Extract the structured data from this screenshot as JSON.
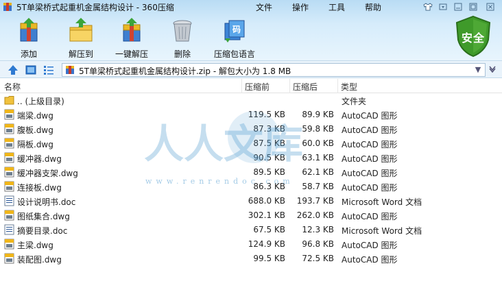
{
  "window": {
    "title": "5T单梁桥式起重机金属结构设计 - 360压缩",
    "menus": [
      "文件",
      "操作",
      "工具",
      "帮助"
    ]
  },
  "toolbar": {
    "add": "添加",
    "extract_to": "解压到",
    "one_click_extract": "一键解压",
    "delete": "删除",
    "archive_language": "压缩包语言",
    "security_badge": "安全"
  },
  "address": {
    "path": "5T单梁桥式起重机金属结构设计.zip - 解包大小为 1.8 MB"
  },
  "columns": {
    "name": "名称",
    "original_size": "压缩前",
    "compressed_size": "压缩后",
    "type": "类型"
  },
  "files": [
    {
      "name": ".. (上级目录)",
      "original": "",
      "compressed": "",
      "type": "文件夹",
      "icon": "folder-icon"
    },
    {
      "name": "端梁.dwg",
      "original": "119.5 KB",
      "compressed": "89.9 KB",
      "type": "AutoCAD 图形",
      "icon": "dwg-file-icon"
    },
    {
      "name": "腹板.dwg",
      "original": "87.3 KB",
      "compressed": "59.8 KB",
      "type": "AutoCAD 图形",
      "icon": "dwg-file-icon"
    },
    {
      "name": "隔板.dwg",
      "original": "87.5 KB",
      "compressed": "60.0 KB",
      "type": "AutoCAD 图形",
      "icon": "dwg-file-icon"
    },
    {
      "name": "缓冲器.dwg",
      "original": "90.5 KB",
      "compressed": "63.1 KB",
      "type": "AutoCAD 图形",
      "icon": "dwg-file-icon"
    },
    {
      "name": "缓冲器支架.dwg",
      "original": "89.5 KB",
      "compressed": "62.1 KB",
      "type": "AutoCAD 图形",
      "icon": "dwg-file-icon"
    },
    {
      "name": "连接板.dwg",
      "original": "86.3 KB",
      "compressed": "58.7 KB",
      "type": "AutoCAD 图形",
      "icon": "dwg-file-icon"
    },
    {
      "name": "设计说明书.doc",
      "original": "688.0 KB",
      "compressed": "193.7 KB",
      "type": "Microsoft Word 文档",
      "icon": "doc-file-icon"
    },
    {
      "name": "图纸集合.dwg",
      "original": "302.1 KB",
      "compressed": "262.0 KB",
      "type": "AutoCAD 图形",
      "icon": "dwg-file-icon"
    },
    {
      "name": "摘要目录.doc",
      "original": "67.5 KB",
      "compressed": "12.3 KB",
      "type": "Microsoft Word 文档",
      "icon": "doc-file-icon"
    },
    {
      "name": "主梁.dwg",
      "original": "124.9 KB",
      "compressed": "96.8 KB",
      "type": "AutoCAD 图形",
      "icon": "dwg-file-icon"
    },
    {
      "name": "装配图.dwg",
      "original": "99.5 KB",
      "compressed": "72.5 KB",
      "type": "AutoCAD 图形",
      "icon": "dwg-file-icon"
    }
  ],
  "watermark": {
    "text": "人人文库",
    "url": "www.renrendoc.com"
  },
  "colors": {
    "title_gradient_top": "#b9dcf4",
    "shield_green": "#3f9a2a",
    "watermark_blue": "#5aa0d2"
  }
}
